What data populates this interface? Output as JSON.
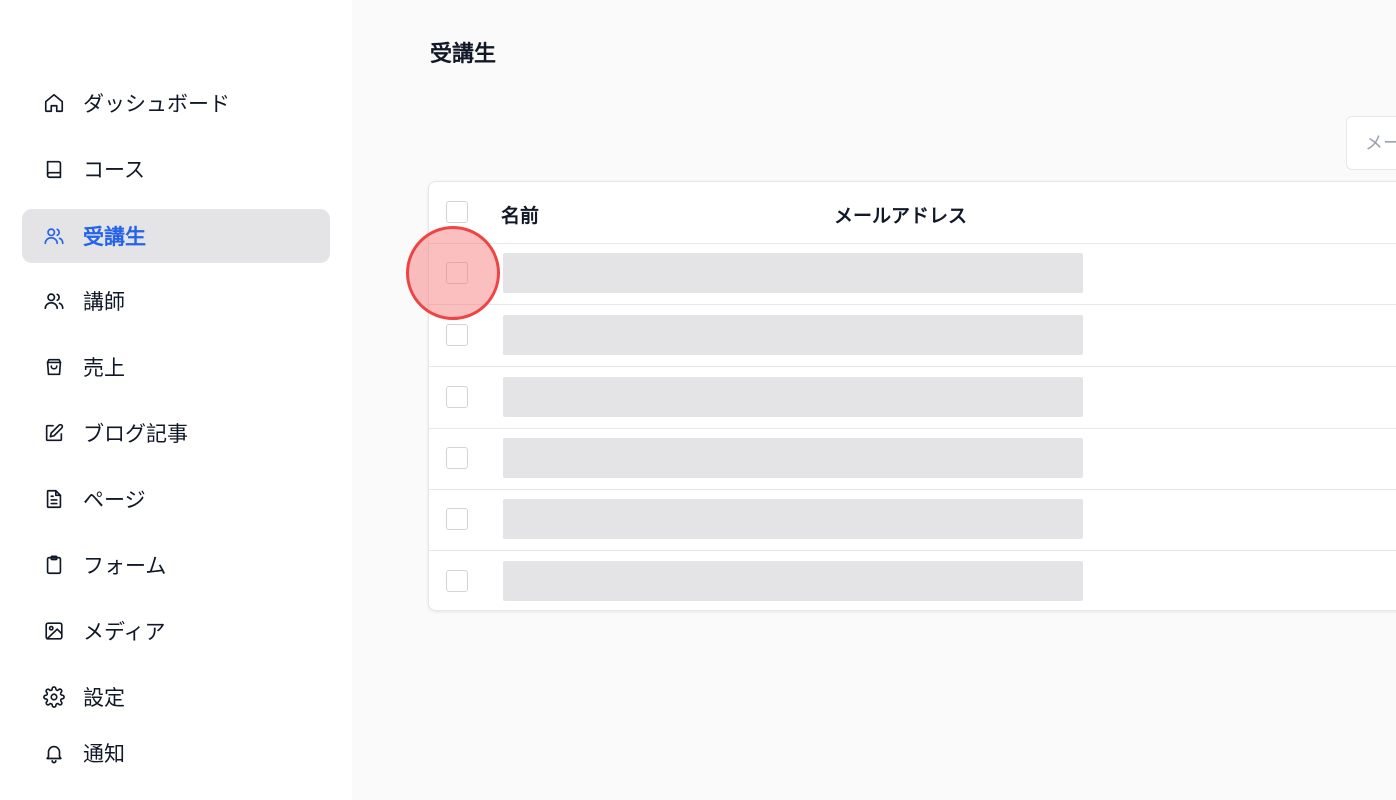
{
  "sidebar": {
    "items": [
      {
        "label": "ダッシュボード",
        "icon": "home-icon",
        "active": false
      },
      {
        "label": "コース",
        "icon": "book-icon",
        "active": false
      },
      {
        "label": "受講生",
        "icon": "users-icon",
        "active": true
      },
      {
        "label": "講師",
        "icon": "users-icon",
        "active": false
      },
      {
        "label": "売上",
        "icon": "shopping-bag-icon",
        "active": false
      },
      {
        "label": "ブログ記事",
        "icon": "edit-icon",
        "active": false
      },
      {
        "label": "ページ",
        "icon": "file-text-icon",
        "active": false
      },
      {
        "label": "フォーム",
        "icon": "clipboard-icon",
        "active": false
      },
      {
        "label": "メディア",
        "icon": "image-icon",
        "active": false
      },
      {
        "label": "設定",
        "icon": "gear-icon",
        "active": false
      },
      {
        "label": "通知",
        "icon": "bell-icon",
        "active": false
      }
    ]
  },
  "main": {
    "title": "受講生",
    "search": {
      "placeholder": "メー"
    },
    "table": {
      "columns": [
        "名前",
        "メールアドレス"
      ],
      "row_count": 6
    }
  },
  "colors": {
    "accent": "#2563eb",
    "active_bg": "#e4e4e7",
    "skeleton": "#e4e4e7",
    "click_marker": "#ef4444"
  }
}
